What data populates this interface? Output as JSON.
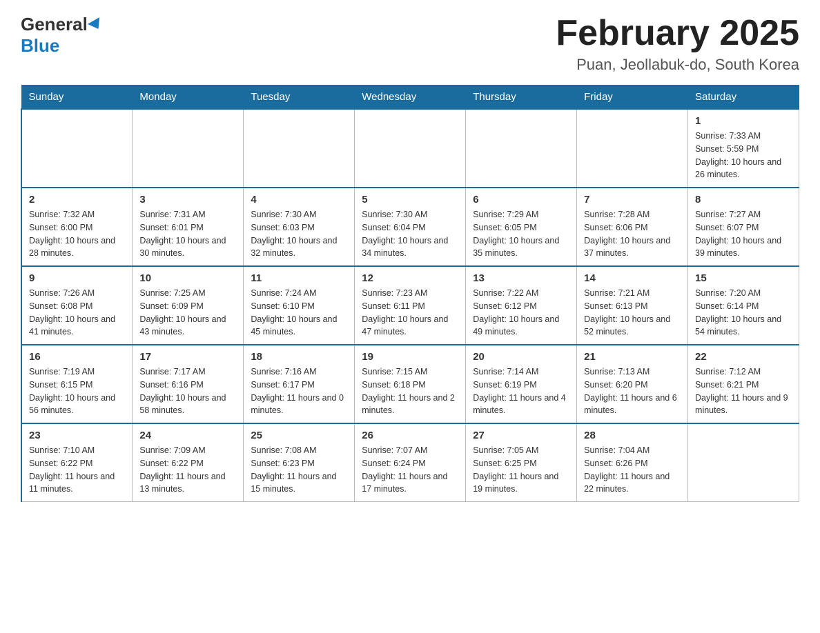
{
  "header": {
    "logo_general": "General",
    "logo_blue": "Blue",
    "title": "February 2025",
    "location": "Puan, Jeollabuk-do, South Korea"
  },
  "weekdays": [
    "Sunday",
    "Monday",
    "Tuesday",
    "Wednesday",
    "Thursday",
    "Friday",
    "Saturday"
  ],
  "weeks": [
    {
      "days": [
        {
          "number": "",
          "info": ""
        },
        {
          "number": "",
          "info": ""
        },
        {
          "number": "",
          "info": ""
        },
        {
          "number": "",
          "info": ""
        },
        {
          "number": "",
          "info": ""
        },
        {
          "number": "",
          "info": ""
        },
        {
          "number": "1",
          "info": "Sunrise: 7:33 AM\nSunset: 5:59 PM\nDaylight: 10 hours and 26 minutes."
        }
      ]
    },
    {
      "days": [
        {
          "number": "2",
          "info": "Sunrise: 7:32 AM\nSunset: 6:00 PM\nDaylight: 10 hours and 28 minutes."
        },
        {
          "number": "3",
          "info": "Sunrise: 7:31 AM\nSunset: 6:01 PM\nDaylight: 10 hours and 30 minutes."
        },
        {
          "number": "4",
          "info": "Sunrise: 7:30 AM\nSunset: 6:03 PM\nDaylight: 10 hours and 32 minutes."
        },
        {
          "number": "5",
          "info": "Sunrise: 7:30 AM\nSunset: 6:04 PM\nDaylight: 10 hours and 34 minutes."
        },
        {
          "number": "6",
          "info": "Sunrise: 7:29 AM\nSunset: 6:05 PM\nDaylight: 10 hours and 35 minutes."
        },
        {
          "number": "7",
          "info": "Sunrise: 7:28 AM\nSunset: 6:06 PM\nDaylight: 10 hours and 37 minutes."
        },
        {
          "number": "8",
          "info": "Sunrise: 7:27 AM\nSunset: 6:07 PM\nDaylight: 10 hours and 39 minutes."
        }
      ]
    },
    {
      "days": [
        {
          "number": "9",
          "info": "Sunrise: 7:26 AM\nSunset: 6:08 PM\nDaylight: 10 hours and 41 minutes."
        },
        {
          "number": "10",
          "info": "Sunrise: 7:25 AM\nSunset: 6:09 PM\nDaylight: 10 hours and 43 minutes."
        },
        {
          "number": "11",
          "info": "Sunrise: 7:24 AM\nSunset: 6:10 PM\nDaylight: 10 hours and 45 minutes."
        },
        {
          "number": "12",
          "info": "Sunrise: 7:23 AM\nSunset: 6:11 PM\nDaylight: 10 hours and 47 minutes."
        },
        {
          "number": "13",
          "info": "Sunrise: 7:22 AM\nSunset: 6:12 PM\nDaylight: 10 hours and 49 minutes."
        },
        {
          "number": "14",
          "info": "Sunrise: 7:21 AM\nSunset: 6:13 PM\nDaylight: 10 hours and 52 minutes."
        },
        {
          "number": "15",
          "info": "Sunrise: 7:20 AM\nSunset: 6:14 PM\nDaylight: 10 hours and 54 minutes."
        }
      ]
    },
    {
      "days": [
        {
          "number": "16",
          "info": "Sunrise: 7:19 AM\nSunset: 6:15 PM\nDaylight: 10 hours and 56 minutes."
        },
        {
          "number": "17",
          "info": "Sunrise: 7:17 AM\nSunset: 6:16 PM\nDaylight: 10 hours and 58 minutes."
        },
        {
          "number": "18",
          "info": "Sunrise: 7:16 AM\nSunset: 6:17 PM\nDaylight: 11 hours and 0 minutes."
        },
        {
          "number": "19",
          "info": "Sunrise: 7:15 AM\nSunset: 6:18 PM\nDaylight: 11 hours and 2 minutes."
        },
        {
          "number": "20",
          "info": "Sunrise: 7:14 AM\nSunset: 6:19 PM\nDaylight: 11 hours and 4 minutes."
        },
        {
          "number": "21",
          "info": "Sunrise: 7:13 AM\nSunset: 6:20 PM\nDaylight: 11 hours and 6 minutes."
        },
        {
          "number": "22",
          "info": "Sunrise: 7:12 AM\nSunset: 6:21 PM\nDaylight: 11 hours and 9 minutes."
        }
      ]
    },
    {
      "days": [
        {
          "number": "23",
          "info": "Sunrise: 7:10 AM\nSunset: 6:22 PM\nDaylight: 11 hours and 11 minutes."
        },
        {
          "number": "24",
          "info": "Sunrise: 7:09 AM\nSunset: 6:22 PM\nDaylight: 11 hours and 13 minutes."
        },
        {
          "number": "25",
          "info": "Sunrise: 7:08 AM\nSunset: 6:23 PM\nDaylight: 11 hours and 15 minutes."
        },
        {
          "number": "26",
          "info": "Sunrise: 7:07 AM\nSunset: 6:24 PM\nDaylight: 11 hours and 17 minutes."
        },
        {
          "number": "27",
          "info": "Sunrise: 7:05 AM\nSunset: 6:25 PM\nDaylight: 11 hours and 19 minutes."
        },
        {
          "number": "28",
          "info": "Sunrise: 7:04 AM\nSunset: 6:26 PM\nDaylight: 11 hours and 22 minutes."
        },
        {
          "number": "",
          "info": ""
        }
      ]
    }
  ]
}
